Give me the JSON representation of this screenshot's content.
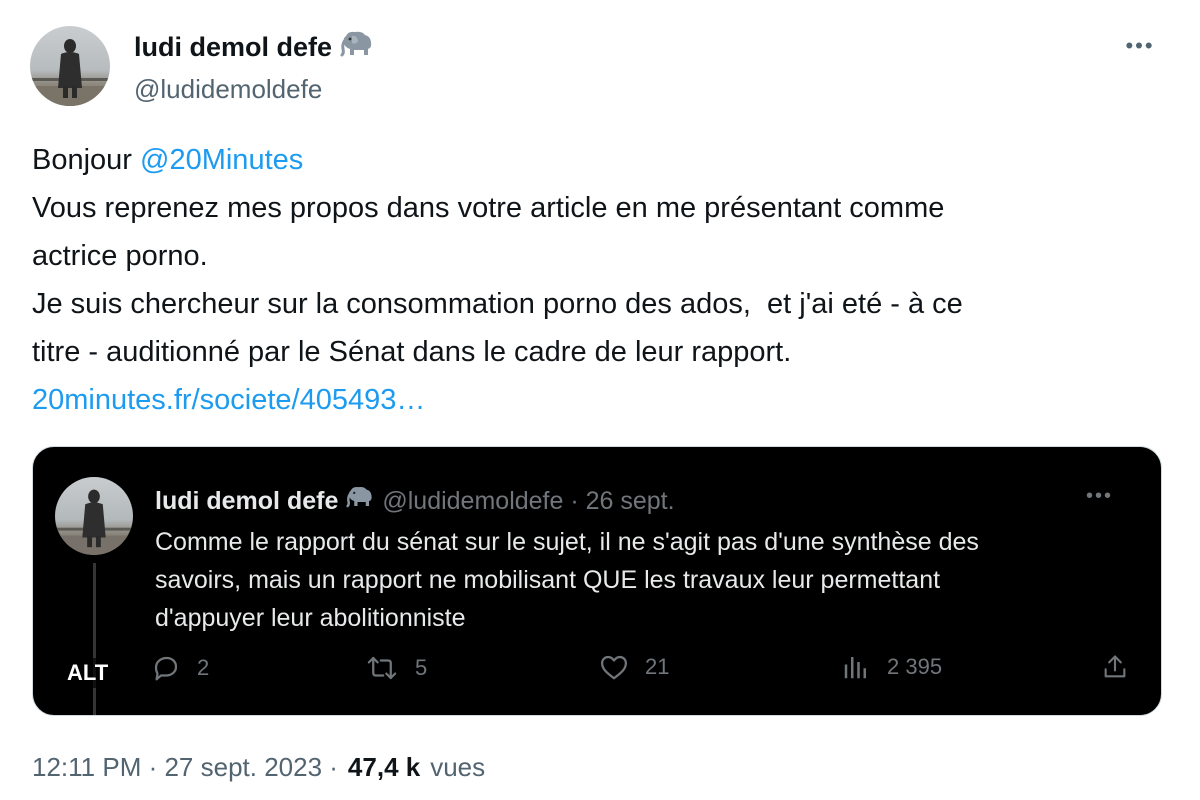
{
  "author": {
    "display_name": "ludi demol defe",
    "handle": "@ludidemoldefe",
    "badge_icon": "elephant-emoji"
  },
  "tweet": {
    "lines": [
      {
        "prefix": "Bonjour ",
        "mention": "@20Minutes"
      },
      {
        "text": "Vous reprenez mes propos dans votre article en me présentant comme"
      },
      {
        "text": "actrice porno."
      },
      {
        "text": "Je suis chercheur sur la consommation porno des ados,  et j'ai eté - à ce"
      },
      {
        "text": "titre - auditionné par le Sénat dans le cadre de leur rapport."
      },
      {
        "link": "20minutes.fr/societe/405493…"
      }
    ]
  },
  "embedded_image": {
    "alt_badge": "ALT",
    "quoted": {
      "display_name": "ludi demol defe",
      "handle_date": "@ludidemoldefe · 26 sept.",
      "lines": [
        "Comme le rapport du sénat sur le sujet, il ne s'agit pas d'une synthèse des",
        "savoirs, mais un rapport ne mobilisant QUE les travaux leur permettant",
        "d'appuyer leur abolitionniste"
      ],
      "stats": {
        "replies": "2",
        "retweets": "5",
        "likes": "21",
        "views": "2 395"
      }
    }
  },
  "footer": {
    "time_date": "12:11 PM · 27 sept. 2023 ·",
    "views_count": "47,4 k",
    "views_label": "vues"
  },
  "colors": {
    "link": "#1d9bf0",
    "text": "#0f1419",
    "secondary": "#536471"
  }
}
